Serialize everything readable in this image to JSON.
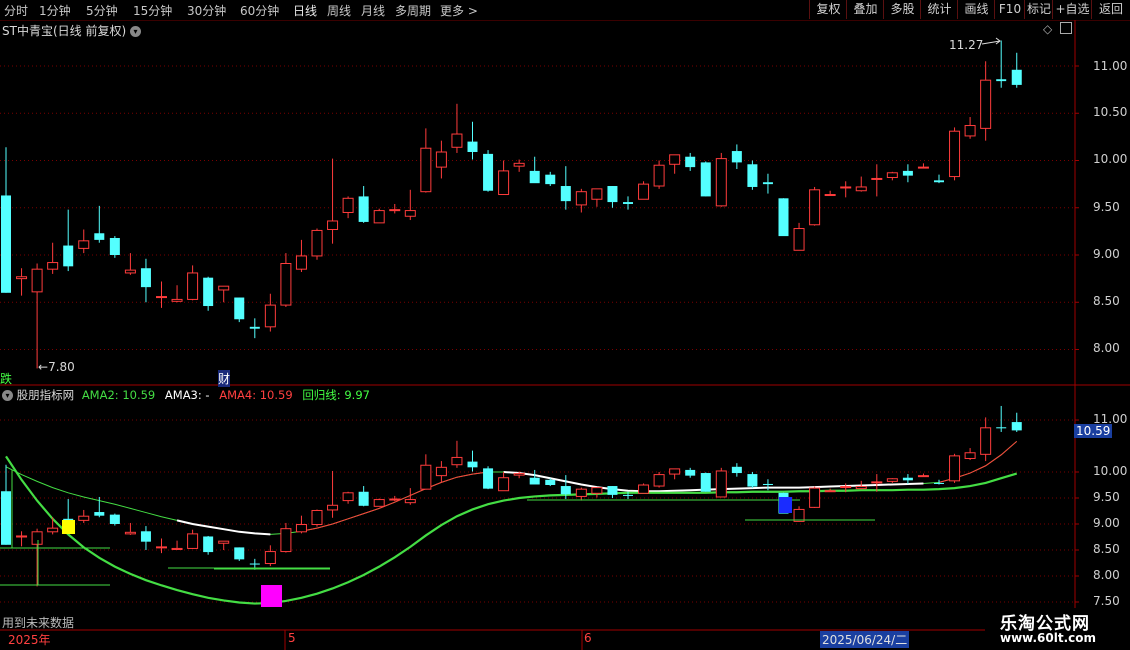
{
  "periods": [
    "分时",
    "1分钟",
    "5分钟",
    "15分钟",
    "30分钟",
    "60分钟",
    "日线",
    "周线",
    "月线",
    "多周期",
    "更多"
  ],
  "active_period": "日线",
  "right_buttons": [
    "复权",
    "叠加",
    "多股",
    "统计",
    "画线",
    "F10",
    "标记",
    "+自选",
    "返回"
  ],
  "main": {
    "title": "ST中青宝(日线 前复权)",
    "y_labels": [
      "11.00",
      "10.50",
      "10.00",
      "9.50",
      "9.00",
      "8.50",
      "8.00"
    ],
    "high_label": "11.27",
    "low_label": "7.80",
    "flag_die": "跌",
    "flag_cai": "财"
  },
  "indicator": {
    "name": "股朋指标网",
    "ama2": "AMA2: 10.59",
    "ama3": "AMA3: -",
    "ama4": "AMA4: 10.59",
    "huigui": "回归线: 9.97",
    "y_labels": [
      "11.00",
      "10.00",
      "9.50",
      "9.00",
      "8.50",
      "8.00",
      "7.50"
    ],
    "current_value": "10.59"
  },
  "footer": {
    "note": "用到未来数据",
    "year": "2025年",
    "month5": "5",
    "month6": "6",
    "date_cursor": "2025/06/24/二"
  },
  "watermark": {
    "line1": "乐淘公式网",
    "line2": "www.60lt.com"
  },
  "colors": {
    "up": "#ff3c3c",
    "down": "#54ffff",
    "grid": "#7a0000",
    "axis": "#a00000",
    "ama_green": "#44dd44",
    "ama_white": "#ffffff"
  },
  "chart_data": {
    "type": "candlestick",
    "candles": [
      [
        9.63,
        10.14,
        8.6,
        8.6
      ],
      [
        8.75,
        8.86,
        8.57,
        8.77
      ],
      [
        8.61,
        8.91,
        7.8,
        8.85
      ],
      [
        8.85,
        9.13,
        8.8,
        8.92
      ],
      [
        9.1,
        9.48,
        8.83,
        8.88
      ],
      [
        9.07,
        9.27,
        9.02,
        9.15
      ],
      [
        9.23,
        9.52,
        9.13,
        9.16
      ],
      [
        9.18,
        9.2,
        8.97,
        9.0
      ],
      [
        8.81,
        9.02,
        8.79,
        8.84
      ],
      [
        8.86,
        8.96,
        8.5,
        8.66
      ],
      [
        8.55,
        8.72,
        8.44,
        8.56
      ],
      [
        8.51,
        8.68,
        8.5,
        8.53
      ],
      [
        8.53,
        8.89,
        8.52,
        8.81
      ],
      [
        8.76,
        8.77,
        8.41,
        8.46
      ],
      [
        8.63,
        8.67,
        8.5,
        8.67
      ],
      [
        8.55,
        8.55,
        8.29,
        8.32
      ],
      [
        8.24,
        8.33,
        8.12,
        8.22
      ],
      [
        8.24,
        8.59,
        8.19,
        8.47
      ],
      [
        8.47,
        9.02,
        8.45,
        8.91
      ],
      [
        8.85,
        9.16,
        8.82,
        8.99
      ],
      [
        8.99,
        9.28,
        8.95,
        9.26
      ],
      [
        9.27,
        10.02,
        9.12,
        9.36
      ],
      [
        9.45,
        9.62,
        9.39,
        9.6
      ],
      [
        9.62,
        9.73,
        9.34,
        9.35
      ],
      [
        9.34,
        9.49,
        9.34,
        9.47
      ],
      [
        9.48,
        9.54,
        9.44,
        9.48
      ],
      [
        9.41,
        9.69,
        9.37,
        9.47
      ],
      [
        9.67,
        10.34,
        9.66,
        10.13
      ],
      [
        9.93,
        10.21,
        9.81,
        10.09
      ],
      [
        10.14,
        10.6,
        10.08,
        10.28
      ],
      [
        10.2,
        10.41,
        10.01,
        10.09
      ],
      [
        10.07,
        10.11,
        9.67,
        9.68
      ],
      [
        9.64,
        10.0,
        9.64,
        9.89
      ],
      [
        9.94,
        10.01,
        9.88,
        9.97
      ],
      [
        9.89,
        10.04,
        9.78,
        9.76
      ],
      [
        9.85,
        9.88,
        9.73,
        9.75
      ],
      [
        9.73,
        9.94,
        9.48,
        9.57
      ],
      [
        9.53,
        9.7,
        9.45,
        9.67
      ],
      [
        9.59,
        9.69,
        9.51,
        9.7
      ],
      [
        9.73,
        9.73,
        9.5,
        9.56
      ],
      [
        9.56,
        9.62,
        9.48,
        9.54
      ],
      [
        9.59,
        9.78,
        9.6,
        9.75
      ],
      [
        9.73,
        10.0,
        9.7,
        9.95
      ],
      [
        9.96,
        10.05,
        9.86,
        10.06
      ],
      [
        10.04,
        10.08,
        9.89,
        9.93
      ],
      [
        9.98,
        9.99,
        9.62,
        9.62
      ],
      [
        9.52,
        10.08,
        9.51,
        10.02
      ],
      [
        10.1,
        10.17,
        9.91,
        9.98
      ],
      [
        9.96,
        10.0,
        9.69,
        9.72
      ],
      [
        9.77,
        9.86,
        9.65,
        9.75
      ],
      [
        9.6,
        9.6,
        9.21,
        9.2
      ],
      [
        9.05,
        9.34,
        9.06,
        9.28
      ],
      [
        9.32,
        9.72,
        9.31,
        9.69
      ],
      [
        9.64,
        9.68,
        9.64,
        9.64
      ],
      [
        9.72,
        9.78,
        9.61,
        9.72
      ],
      [
        9.68,
        9.83,
        9.67,
        9.72
      ],
      [
        9.8,
        9.96,
        9.62,
        9.81
      ],
      [
        9.82,
        9.88,
        9.79,
        9.87
      ],
      [
        9.89,
        9.96,
        9.77,
        9.84
      ],
      [
        9.92,
        9.97,
        9.92,
        9.93
      ],
      [
        9.79,
        9.85,
        9.76,
        9.77
      ],
      [
        9.83,
        10.35,
        9.79,
        10.31
      ],
      [
        10.26,
        10.46,
        10.23,
        10.37
      ],
      [
        10.34,
        11.05,
        10.21,
        10.85
      ],
      [
        10.86,
        11.27,
        10.77,
        10.84
      ],
      [
        10.96,
        11.14,
        10.77,
        10.8
      ]
    ],
    "ama2": [
      10.1,
      9.95,
      9.82,
      9.7,
      9.6,
      9.52,
      9.45,
      9.38,
      9.3,
      9.22,
      9.14,
      9.07,
      9.0,
      8.95,
      8.9,
      8.85,
      8.82,
      8.8,
      8.82,
      8.86,
      8.92,
      9.0,
      9.1,
      9.2,
      9.3,
      9.42,
      9.55,
      9.68,
      9.8,
      9.9,
      9.96,
      10.0,
      10.0,
      9.98,
      9.94,
      9.88,
      9.82,
      9.76,
      9.71,
      9.67,
      9.64,
      9.63,
      9.63,
      9.64,
      9.65,
      9.66,
      9.67,
      9.68,
      9.69,
      9.7,
      9.7,
      9.7,
      9.71,
      9.72,
      9.73,
      9.74,
      9.75,
      9.76,
      9.77,
      9.78,
      9.8,
      9.88,
      9.98,
      10.12,
      10.33,
      10.59
    ],
    "ama3": [
      10.1,
      9.95,
      9.82,
      9.7,
      9.6,
      9.52,
      9.45,
      9.38,
      9.3,
      9.22,
      9.14,
      9.07,
      9.0,
      8.95,
      8.9,
      8.85,
      8.82,
      8.8,
      8.82,
      8.86,
      8.92,
      9.0,
      9.1,
      9.2,
      9.3,
      9.42,
      9.55,
      9.68,
      9.8,
      9.9,
      9.96,
      10.0,
      10.0,
      9.98,
      9.94,
      9.88,
      9.82,
      9.76,
      9.71,
      9.67,
      9.64,
      9.63,
      9.63,
      9.64,
      9.65,
      9.66,
      9.67,
      9.68,
      9.69,
      9.7,
      9.7,
      9.7,
      9.71,
      9.72,
      9.73,
      9.74,
      9.75,
      9.76,
      9.77,
      9.78,
      9.8,
      9.88,
      9.98,
      10.12,
      10.33,
      10.59
    ],
    "huigui": [
      10.3,
      9.85,
      9.45,
      9.1,
      8.8,
      8.55,
      8.35,
      8.18,
      8.04,
      7.92,
      7.82,
      7.73,
      7.65,
      7.58,
      7.53,
      7.49,
      7.47,
      7.48,
      7.52,
      7.58,
      7.66,
      7.76,
      7.88,
      8.02,
      8.18,
      8.36,
      8.56,
      8.78,
      8.98,
      9.15,
      9.28,
      9.38,
      9.45,
      9.5,
      9.53,
      9.55,
      9.56,
      9.57,
      9.58,
      9.59,
      9.6,
      9.6,
      9.6,
      9.6,
      9.6,
      9.6,
      9.61,
      9.61,
      9.62,
      9.62,
      9.62,
      9.63,
      9.63,
      9.64,
      9.64,
      9.65,
      9.65,
      9.65,
      9.66,
      9.66,
      9.67,
      9.69,
      9.73,
      9.79,
      9.88,
      9.97
    ]
  }
}
